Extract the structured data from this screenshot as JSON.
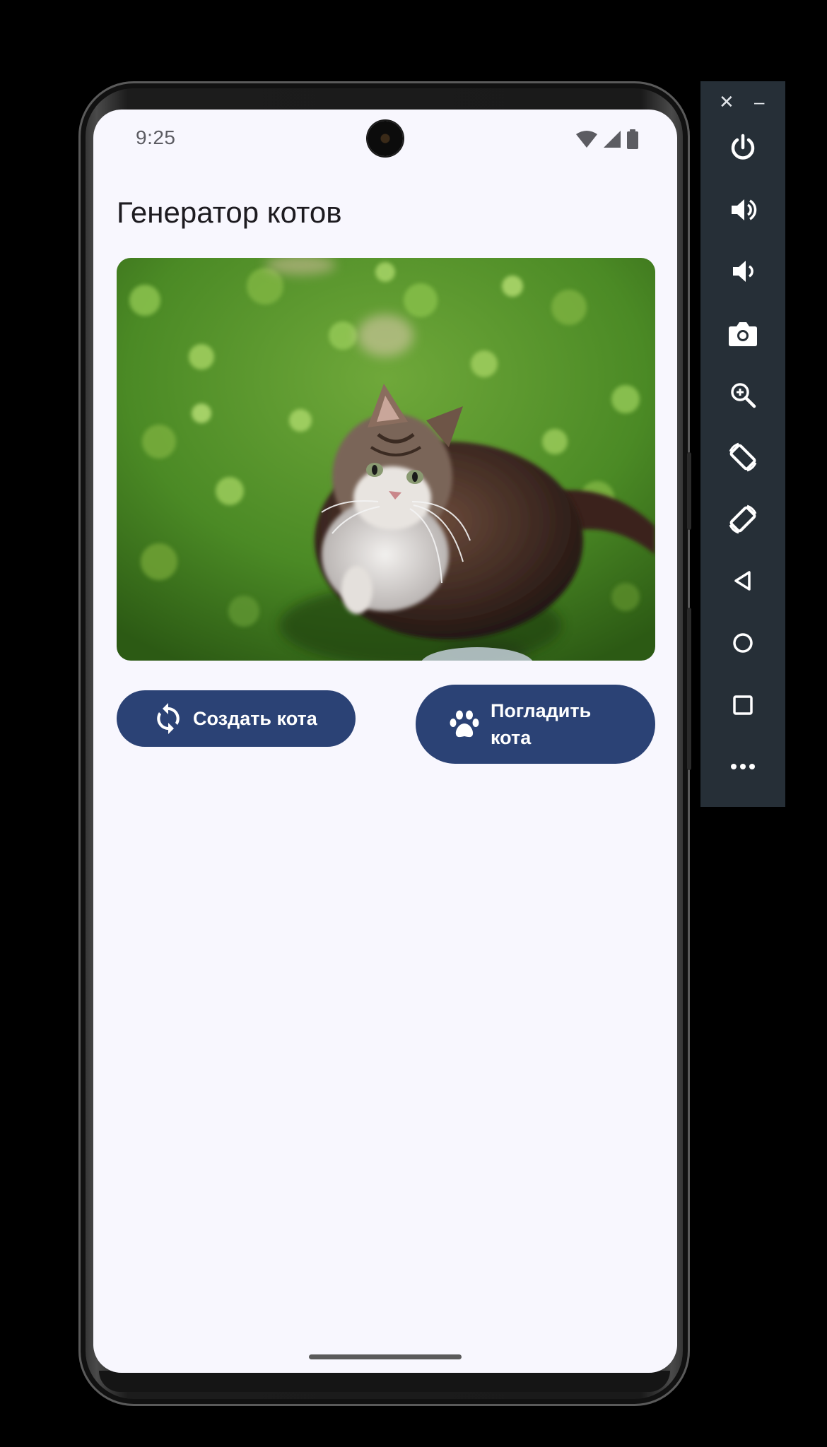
{
  "status_bar": {
    "time": "9:25"
  },
  "app": {
    "title": "Генератор котов",
    "create_button_label": "Создать кота",
    "pet_button_label": "Погладить кота",
    "create_icon": "refresh-icon",
    "pet_icon": "paw-icon",
    "button_color": "#2b4275",
    "background_color": "#f8f7fe"
  },
  "emulator_toolbar": {
    "close": "✕",
    "minimize": "–",
    "tools": [
      "power-icon",
      "volume-up-icon",
      "volume-down-icon",
      "camera-icon",
      "zoom-icon",
      "rotate-left-icon",
      "rotate-right-icon",
      "back-icon",
      "home-icon",
      "overview-icon",
      "more-icon"
    ]
  }
}
